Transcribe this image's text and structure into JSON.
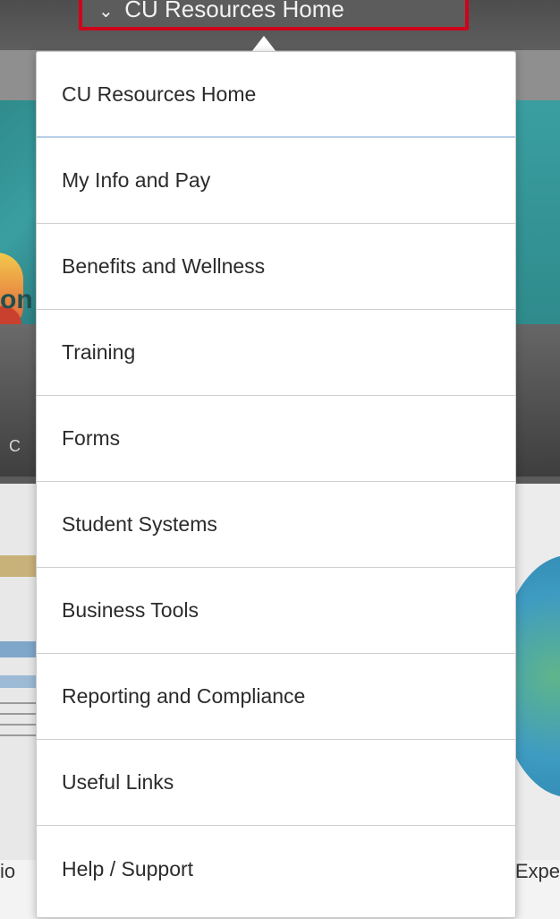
{
  "trigger": {
    "label": "CU Resources Home",
    "chevron": "chevron-down-icon"
  },
  "menu": {
    "items": [
      {
        "label": "CU Resources Home"
      },
      {
        "label": "My Info and Pay"
      },
      {
        "label": "Benefits and Wellness"
      },
      {
        "label": "Training"
      },
      {
        "label": "Forms"
      },
      {
        "label": "Student Systems"
      },
      {
        "label": "Business Tools"
      },
      {
        "label": "Reporting and Compliance"
      },
      {
        "label": "Useful Links"
      },
      {
        "label": "Help / Support"
      }
    ]
  },
  "background": {
    "left_letter": "on",
    "left_small": "C",
    "bottom_left": "io",
    "bottom_right": "Expe"
  },
  "colors": {
    "highlight": "#d0021b",
    "menu_bg": "#ffffff",
    "selected_divider": "#b8cfe6"
  }
}
